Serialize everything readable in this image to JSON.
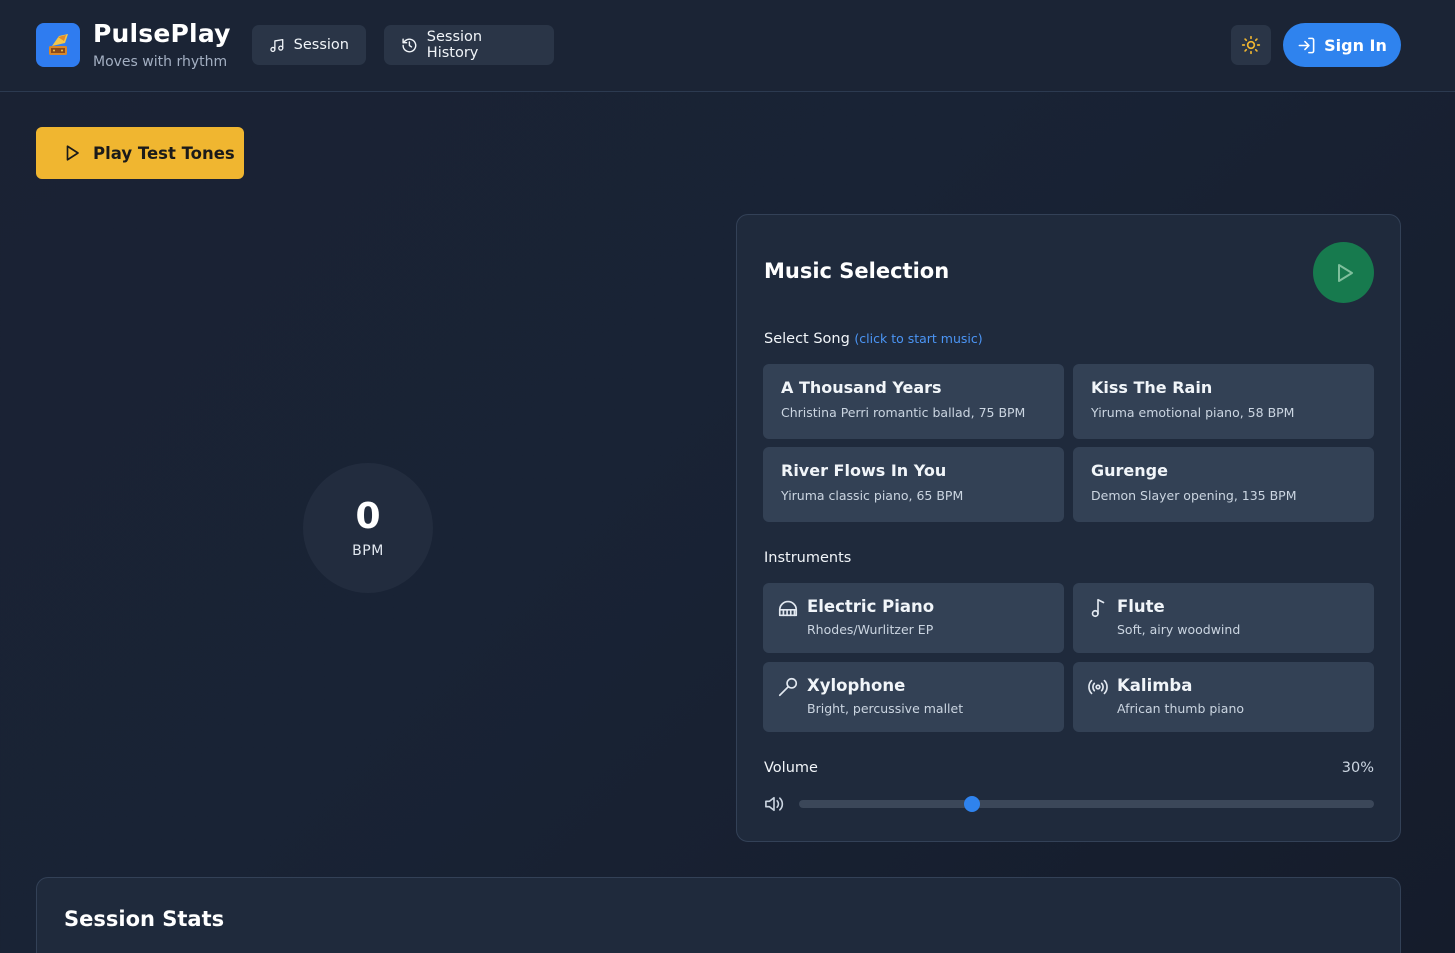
{
  "brand": {
    "title": "PulsePlay",
    "subtitle": "Moves with rhythm",
    "accent": "#2f7cf0"
  },
  "nav": {
    "session_label": "Session",
    "history_label": "Session History"
  },
  "header_actions": {
    "theme_icon": "sun-icon",
    "signin_label": "Sign In"
  },
  "test_tones": {
    "label": "Play Test Tones",
    "color": "#f0b630"
  },
  "bpm": {
    "value": "0",
    "unit": "BPM"
  },
  "music": {
    "title": "Music Selection",
    "select_label": "Select Song",
    "select_hint": "(click to start music)",
    "songs": [
      {
        "name": "A Thousand Years",
        "desc": "Christina Perri romantic ballad, 75 BPM"
      },
      {
        "name": "Kiss The Rain",
        "desc": "Yiruma emotional piano, 58 BPM"
      },
      {
        "name": "River Flows In You",
        "desc": "Yiruma classic piano, 65 BPM"
      },
      {
        "name": "Gurenge",
        "desc": "Demon Slayer opening, 135 BPM"
      }
    ],
    "instruments_label": "Instruments",
    "instruments": [
      {
        "name": "Electric Piano",
        "desc": "Rhodes/Wurlitzer EP",
        "icon": "piano-icon"
      },
      {
        "name": "Flute",
        "desc": "Soft, airy woodwind",
        "icon": "music-note-icon"
      },
      {
        "name": "Xylophone",
        "desc": "Bright, percussive mallet",
        "icon": "mallet-icon"
      },
      {
        "name": "Kalimba",
        "desc": "African thumb piano",
        "icon": "radio-waves-icon"
      }
    ],
    "volume_label": "Volume",
    "volume_text": "30%",
    "volume_value": 30
  },
  "stats": {
    "title": "Session Stats"
  }
}
